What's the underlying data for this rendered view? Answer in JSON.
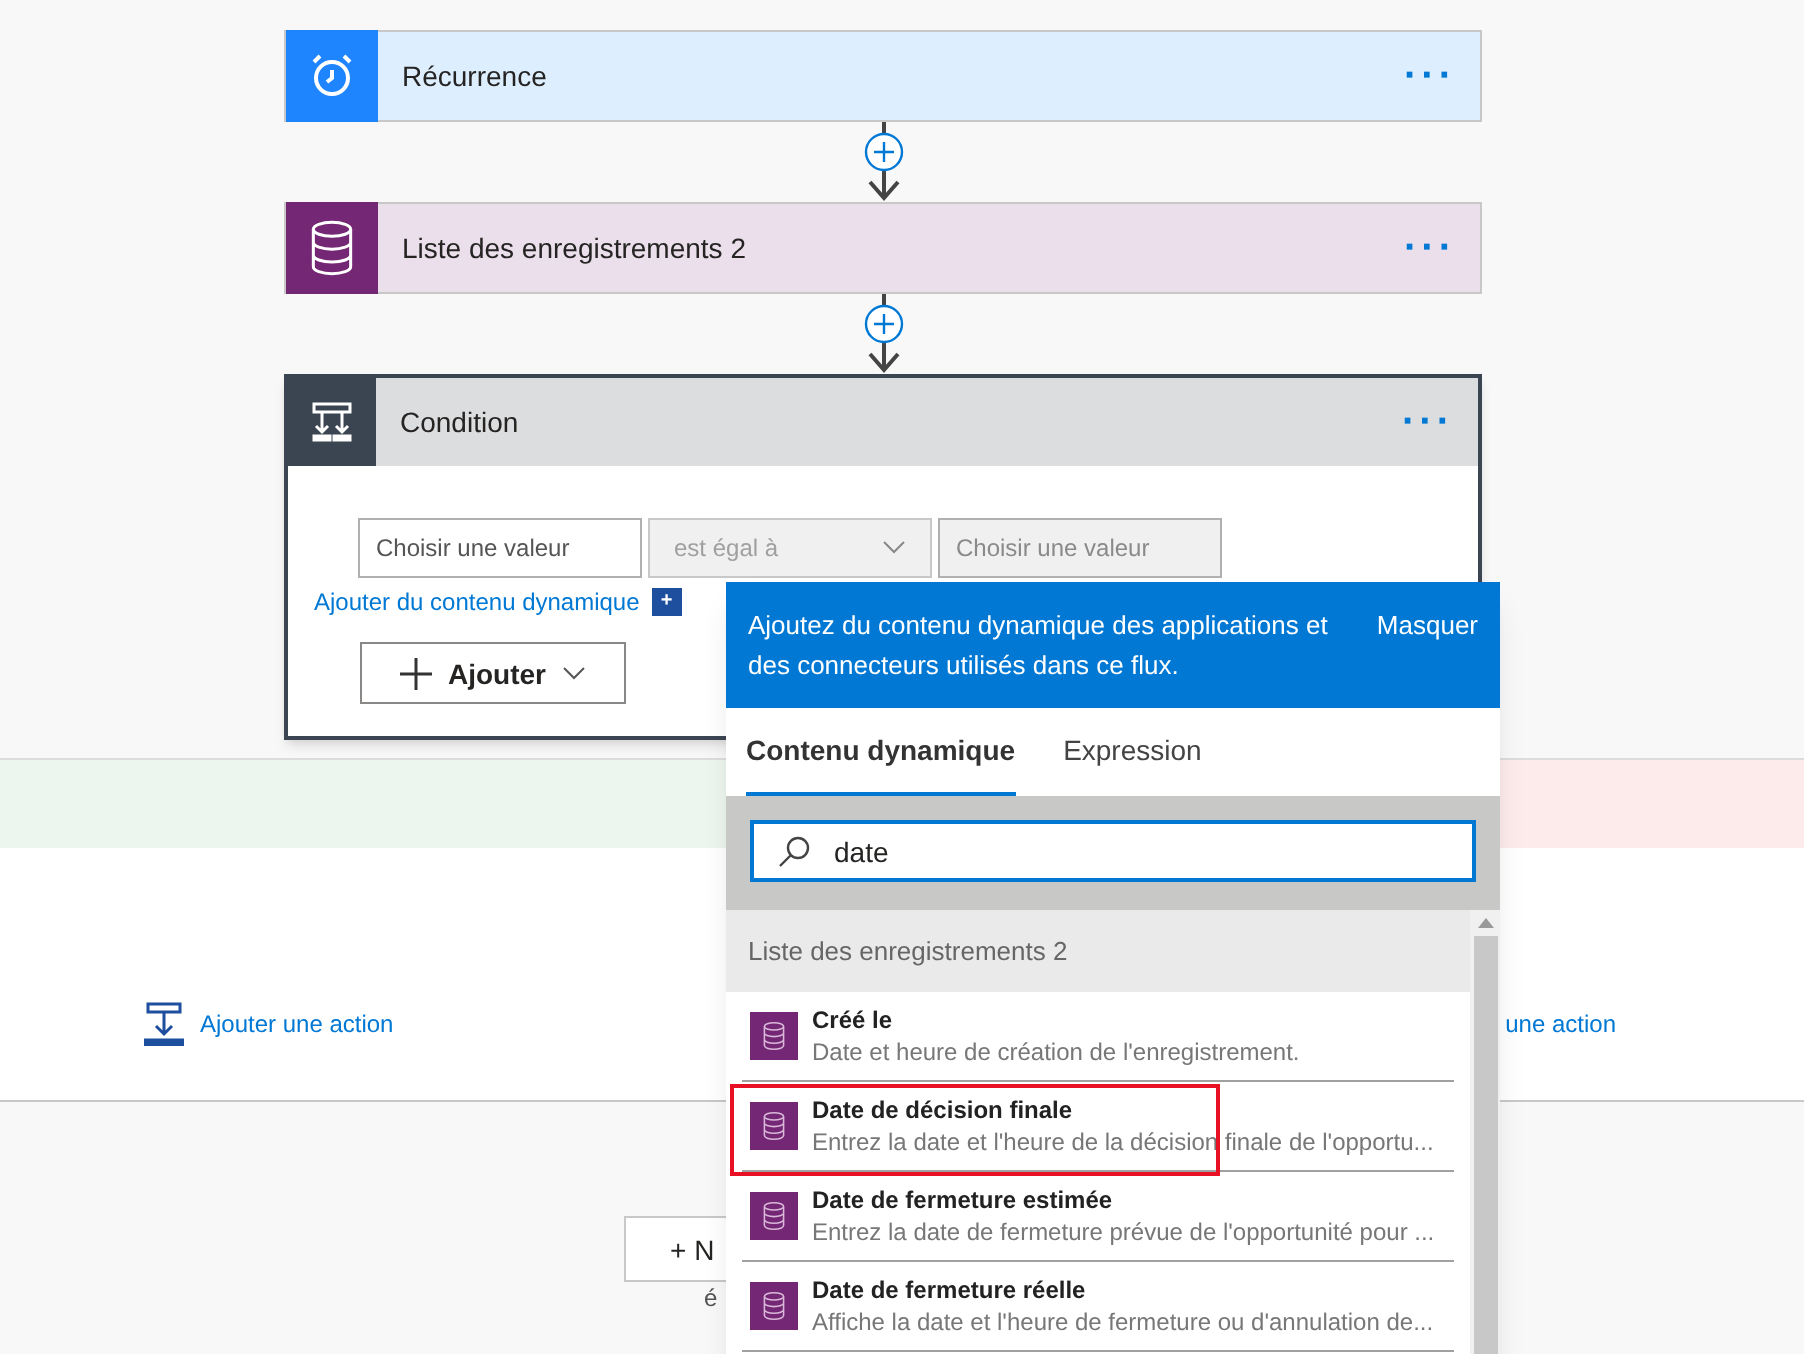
{
  "steps": [
    {
      "kind": "recurrence",
      "title": "Récurrence",
      "menu": "···"
    },
    {
      "kind": "records",
      "title": "Liste des enregistrements 2",
      "menu": "···"
    }
  ],
  "condition": {
    "title": "Condition",
    "menu": "···",
    "left_value": {
      "placeholder": "Choisir une valeur"
    },
    "operator": {
      "value": "est égal à",
      "disabled": true
    },
    "right_value": {
      "placeholder": "Choisir une valeur",
      "disabled": true
    },
    "dynamic_link": "Ajouter du contenu dynamique",
    "dynamic_button": "+",
    "add_button": "Ajouter"
  },
  "branches": {
    "yes_action": "Ajouter une action",
    "no_action": "une action"
  },
  "new_step": {
    "button": "+ N",
    "caption": "é"
  },
  "popup": {
    "message": "Ajoutez du contenu dynamique des applications et des connecteurs utilisés dans ce flux.",
    "hide": "Masquer",
    "tabs": [
      {
        "label": "Contenu dynamique",
        "selected": true
      },
      {
        "label": "Expression",
        "selected": false
      }
    ],
    "search": {
      "value": "date"
    },
    "group": "Liste des enregistrements 2",
    "items": [
      {
        "title": "Créé le",
        "description": "Date et heure de création de l'enregistrement.",
        "highlighted": false
      },
      {
        "title": "Date de décision finale",
        "description": "Entrez la date et l'heure de la décision finale de l'opportu...",
        "highlighted": true
      },
      {
        "title": "Date de fermeture estimée",
        "description": "Entrez la date de fermeture prévue de l'opportunité pour ...",
        "highlighted": false
      },
      {
        "title": "Date de fermeture réelle",
        "description": "Affiche la date et l'heure de fermeture ou d'annulation de...",
        "highlighted": false
      }
    ]
  }
}
